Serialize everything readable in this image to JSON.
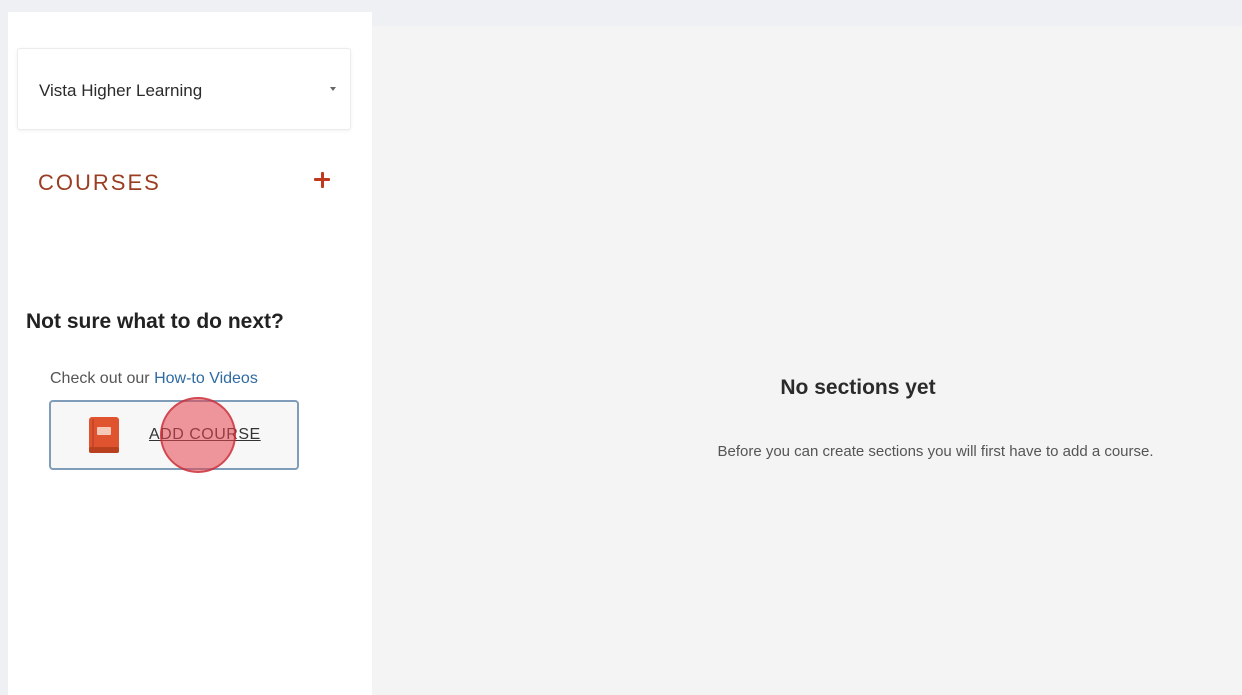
{
  "sidebar": {
    "org_select": {
      "value": "Vista Higher Learning"
    },
    "courses_heading": "COURSES",
    "help": {
      "heading": "Not sure what to do next?",
      "prefix": "Check out our ",
      "link_text": "How-to Videos"
    },
    "add_course_button": {
      "label": "ADD COURSE"
    }
  },
  "main": {
    "empty_state": {
      "title": "No sections yet",
      "description": "Before you can create sections you will first have to add a course."
    }
  },
  "colors": {
    "accent": "#c0391b",
    "courses_heading": "#9a3d22",
    "link": "#2f6aa1",
    "button_border": "#7f9db8",
    "book_icon": "#e0532f"
  },
  "icons": {
    "dropdown": "chevron-down-icon",
    "add": "plus-icon",
    "course": "book-icon"
  }
}
